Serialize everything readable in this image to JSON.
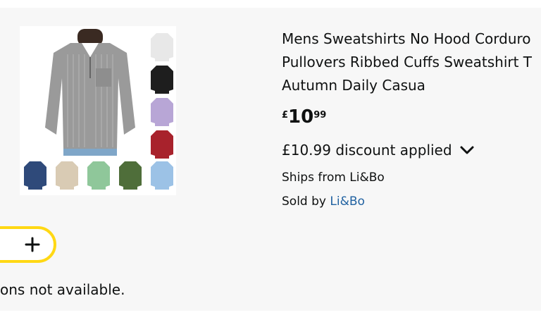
{
  "product": {
    "title_lines": [
      "Mens Sweatshirts No Hood Corduro",
      "Pullovers Ribbed Cuffs Sweatshirt T",
      "Autumn Daily Casua"
    ],
    "price": {
      "currency": "£",
      "whole": "10",
      "fraction": "99"
    },
    "discount_text": "£10.99 discount applied",
    "ships_from": "Ships from Li&Bo",
    "sold_by_prefix": "Sold by ",
    "seller": "Li&Bo",
    "variant_colors": [
      "#e8e8e8",
      "#1e1e1e",
      "#b8a6d6",
      "#a8222c",
      "#2f4a7a",
      "#d9cbb4",
      "#8fc79a",
      "#4f6e3a",
      "#9cc2e6"
    ],
    "main_color": "#9a9a9a"
  },
  "quantity": {
    "plus_icon": "plus-icon",
    "accent": "#ffd814"
  },
  "availability_note": "ons not available."
}
